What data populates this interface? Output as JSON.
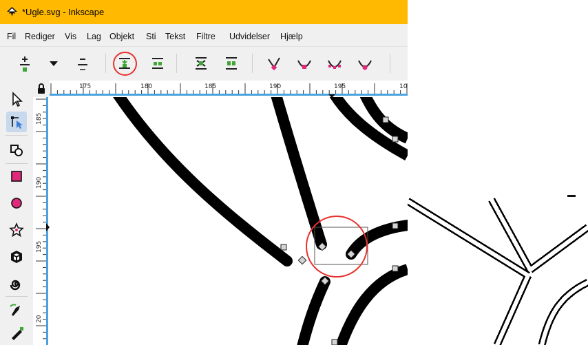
{
  "window": {
    "title": "*Ugle.svg - Inkscape",
    "accent_color": "#ffb900"
  },
  "menu": [
    {
      "label": "Fil"
    },
    {
      "label": "Rediger"
    },
    {
      "label": "Vis"
    },
    {
      "label": "Lag"
    },
    {
      "label": "Objekt"
    },
    {
      "label": "Sti"
    },
    {
      "label": "Tekst"
    },
    {
      "label": "Filtre"
    },
    {
      "label": "Udvidelser"
    },
    {
      "label": "Hjælp"
    }
  ],
  "toolbar": {
    "buttons": [
      {
        "icon": "insert-node-icon"
      },
      {
        "icon": "insert-dropdown-icon"
      },
      {
        "icon": "delete-node-icon"
      },
      {
        "icon": "join-nodes-icon",
        "highlighted": true
      },
      {
        "icon": "break-path-icon"
      },
      {
        "icon": "join-segment-icon"
      },
      {
        "icon": "delete-segment-icon"
      },
      {
        "icon": "node-cusp-icon"
      },
      {
        "icon": "node-smooth-icon"
      },
      {
        "icon": "node-symmetric-icon"
      },
      {
        "icon": "node-auto-smooth-icon"
      }
    ]
  },
  "tools": [
    {
      "icon": "selector-tool-icon"
    },
    {
      "icon": "node-tool-icon",
      "active": true
    },
    {
      "icon": "tweak-tool-icon"
    },
    {
      "icon": "rectangle-tool-icon"
    },
    {
      "icon": "ellipse-tool-icon"
    },
    {
      "icon": "star-tool-icon"
    },
    {
      "icon": "3d-box-tool-icon"
    },
    {
      "icon": "spiral-tool-icon"
    },
    {
      "icon": "pen-tool-icon"
    },
    {
      "icon": "calligraphy-tool-icon"
    }
  ],
  "rulers": {
    "horizontal_labels": [
      "175",
      "180",
      "185",
      "190",
      "195",
      "10"
    ],
    "vertical_labels": [
      "185",
      "190",
      "195",
      "20"
    ]
  },
  "colors": {
    "ruler_blue": "#4aa3df",
    "highlight_red": "#e8312c",
    "node_handle": "#d4d4d4"
  }
}
